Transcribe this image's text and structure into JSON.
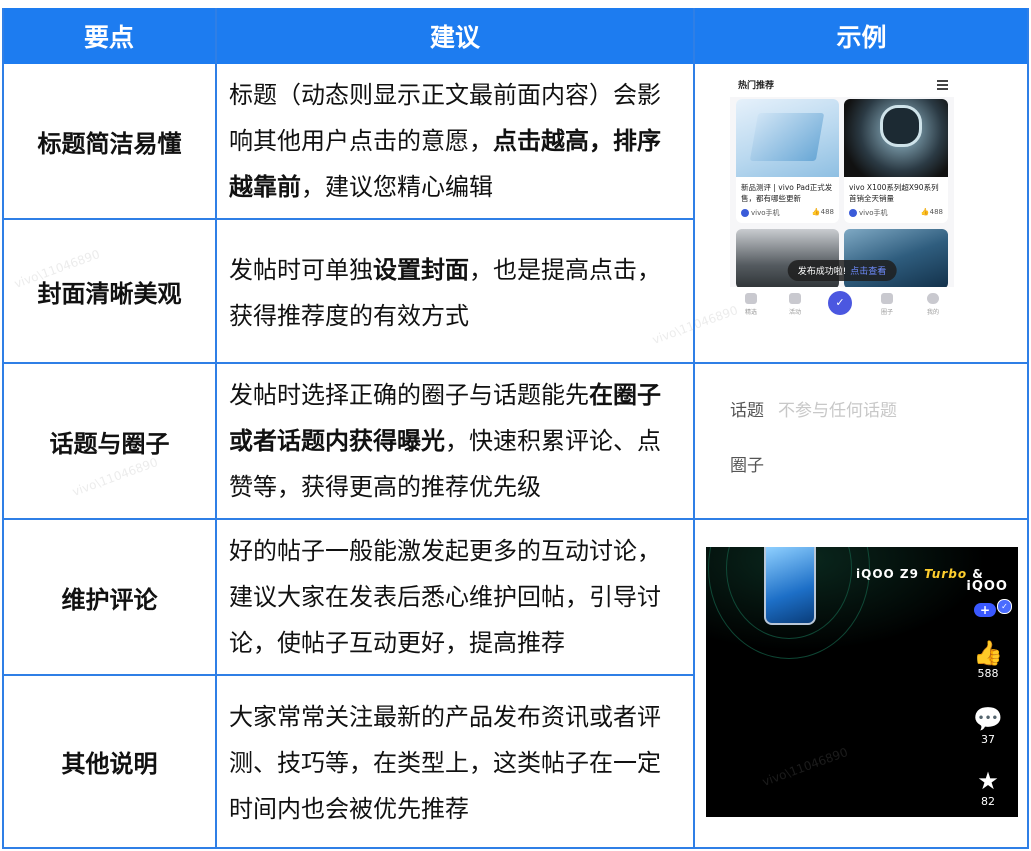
{
  "headers": [
    "要点",
    "建议",
    "示例"
  ],
  "rows": [
    {
      "key": "标题简洁易懂",
      "segments": [
        {
          "text": "标题（动态则显示正文最前面内容）会影响其他用户点击的意愿，",
          "bold": false
        },
        {
          "text": "点击越高，排序越靠前",
          "bold": true
        },
        {
          "text": "，建议您精心编辑",
          "bold": false
        }
      ]
    },
    {
      "key": "封面清晰美观",
      "segments": [
        {
          "text": "发帖时可单独",
          "bold": false
        },
        {
          "text": "设置封面",
          "bold": true
        },
        {
          "text": "，也是提高点击，获得推荐度的有效方式",
          "bold": false
        }
      ]
    },
    {
      "key": "话题与圈子",
      "segments": [
        {
          "text": "发帖时选择正确的圈子与话题能先",
          "bold": false
        },
        {
          "text": "在圈子或者话题内获得曝光",
          "bold": true
        },
        {
          "text": "，快速积累评论、点赞等，获得更高的推荐优先级",
          "bold": false
        }
      ]
    },
    {
      "key": "维护评论",
      "segments": [
        {
          "text": "好的帖子一般能激发起更多的互动讨论，建议大家在发表后悉心维护回帖，引导讨论，使帖子互动更好，提高推荐",
          "bold": false
        }
      ]
    },
    {
      "key": "其他说明",
      "segments": [
        {
          "text": "大家常常关注最新的产品发布资讯或者评测、技巧等，在类型上，这类帖子在一定时间内也会被优先推荐",
          "bold": false
        }
      ]
    }
  ],
  "example_feed": {
    "header": "热门推荐",
    "cards": [
      {
        "title": "新品测评 | vivo Pad正式发售，都有哪些更新",
        "author": "vivo手机",
        "likes": "488"
      },
      {
        "title": "vivo X100系列超X90系列首销全天销量",
        "author": "vivo手机",
        "likes": "488"
      }
    ],
    "toast": "发布成功啦!",
    "toast_action": "点击查看",
    "tabs": [
      "精选",
      "活动",
      "",
      "圈子",
      "我的"
    ]
  },
  "example_form": {
    "topic_label": "话题",
    "topic_placeholder": "不参与任何话题",
    "circle_label": "圈子"
  },
  "example_video": {
    "brand": "iQOO Z9",
    "brand_accent": "Turbo",
    "brand_suffix": "&",
    "logo": "iQOO",
    "likes": "588",
    "comments": "37",
    "favorites": "82"
  },
  "watermark": "vivo\\11046890",
  "colors": {
    "header_bg": "#1d7cf0",
    "grid": "#2f7fe6"
  }
}
